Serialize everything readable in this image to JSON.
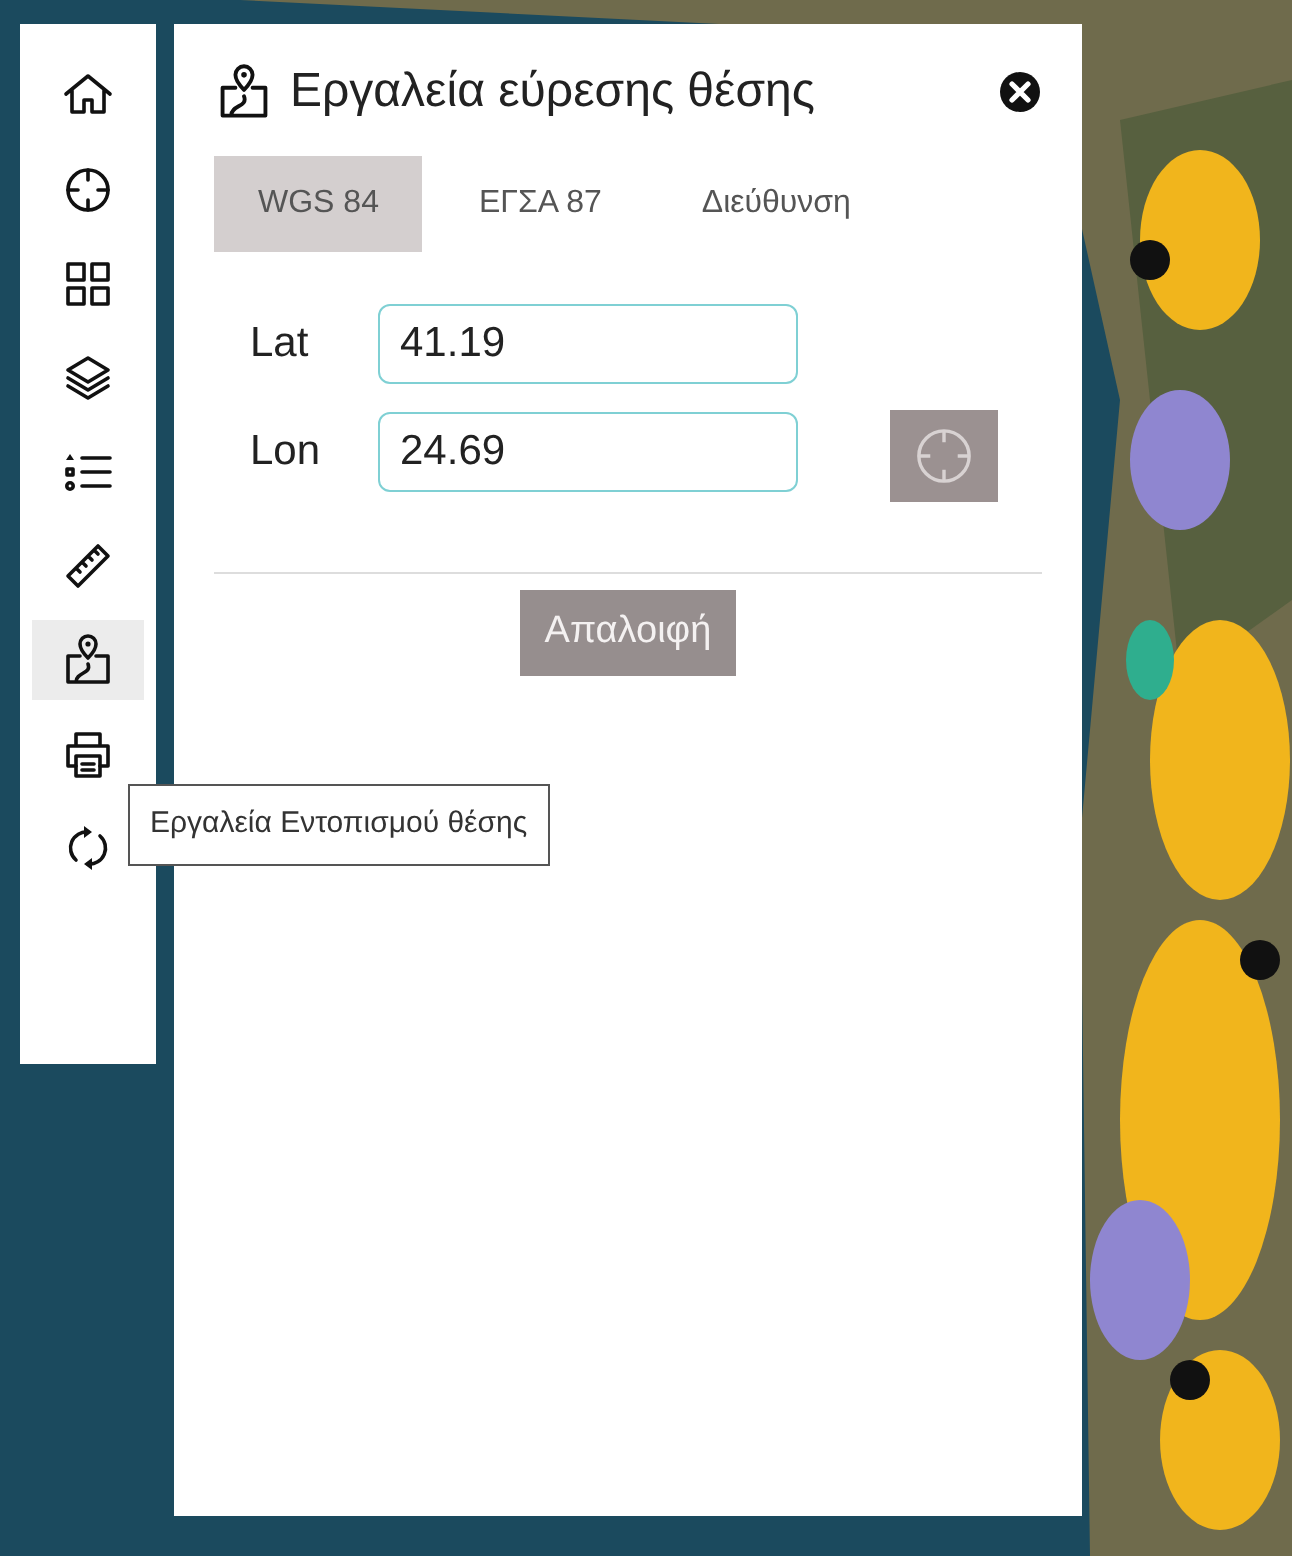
{
  "toolbar": {
    "items": [
      {
        "kind": "home",
        "selected": false
      },
      {
        "kind": "target",
        "selected": false
      },
      {
        "kind": "grid",
        "selected": false
      },
      {
        "kind": "layers",
        "selected": false
      },
      {
        "kind": "list",
        "selected": false
      },
      {
        "kind": "ruler",
        "selected": false
      },
      {
        "kind": "map-pin",
        "selected": true
      },
      {
        "kind": "printer",
        "selected": false
      },
      {
        "kind": "refresh",
        "selected": false
      }
    ],
    "tooltip": "Εργαλεία Εντοπισμού θέσης"
  },
  "panel": {
    "title": "Εργαλεία εύρεσης θέσης",
    "tabs": [
      {
        "label": "WGS 84",
        "selected": true
      },
      {
        "label": "ΕΓΣΑ 87",
        "selected": false
      },
      {
        "label": "Διεύθυνση",
        "selected": false
      }
    ],
    "fields": [
      {
        "label": "Lat",
        "value": "41.19"
      },
      {
        "label": "Lon",
        "value": "24.69"
      }
    ],
    "clear_button": "Απαλοιφή"
  }
}
